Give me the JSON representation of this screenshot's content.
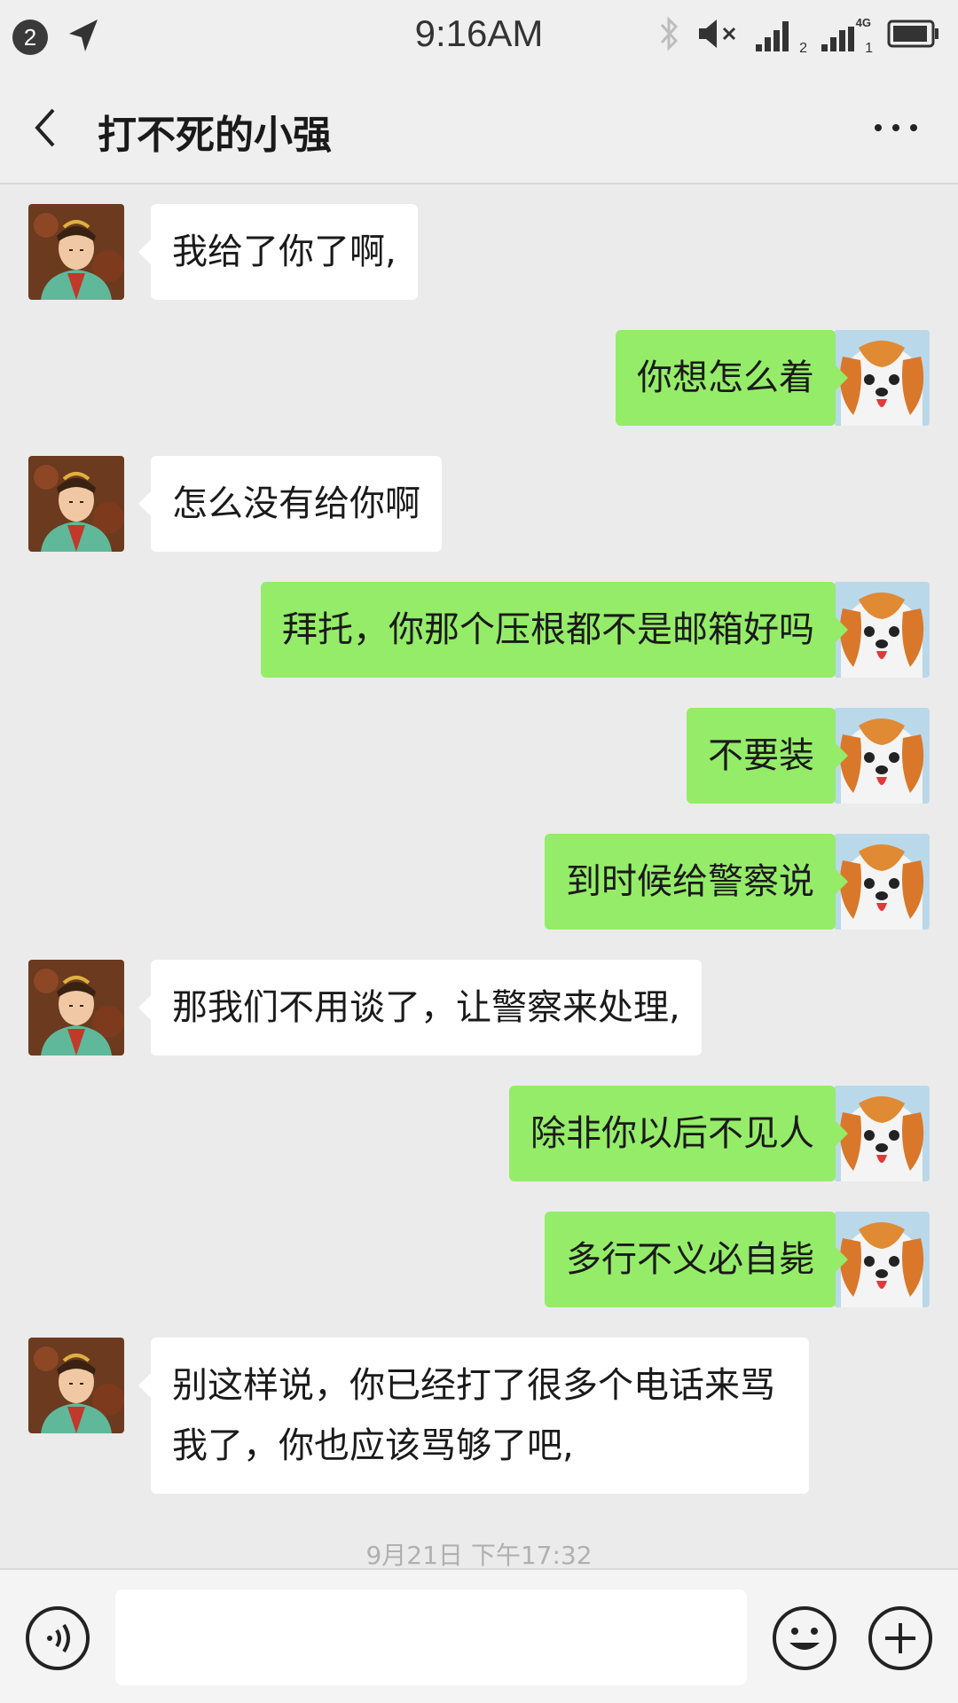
{
  "status_bar": {
    "notification_count": "2",
    "time": "9:16AM",
    "sim1_label": "2",
    "sim2_label": "1",
    "network": "4G"
  },
  "header": {
    "title": "打不死的小强"
  },
  "messages": [
    {
      "side": "left",
      "text": "我给了你了啊,"
    },
    {
      "side": "right",
      "text": "你想怎么着"
    },
    {
      "side": "left",
      "text": "怎么没有给你啊"
    },
    {
      "side": "right",
      "text": "拜托，你那个压根都不是邮箱好吗"
    },
    {
      "side": "right",
      "text": "不要装"
    },
    {
      "side": "right",
      "text": "到时候给警察说"
    },
    {
      "side": "left",
      "text": "那我们不用谈了，让警察来处理,"
    },
    {
      "side": "right",
      "text": "除非你以后不见人"
    },
    {
      "side": "right",
      "text": "多行不义必自毙"
    },
    {
      "side": "left",
      "text": "别这样说，你已经打了很多个电话来骂我了，你也应该骂够了吧,"
    }
  ],
  "timestamp": "9月21日 下午17:32",
  "input": {
    "value": "",
    "placeholder": ""
  },
  "icons": {
    "back": "chevron-left-icon",
    "more": "more-dots-icon",
    "voice": "voice-icon",
    "emoji": "emoji-icon",
    "plus": "plus-icon",
    "location": "location-arrow-icon",
    "bluetooth": "bluetooth-icon",
    "mute": "mute-icon",
    "battery": "battery-icon"
  },
  "colors": {
    "sent_bubble": "#95ec69",
    "received_bubble": "#ffffff",
    "background": "#ebebeb"
  }
}
